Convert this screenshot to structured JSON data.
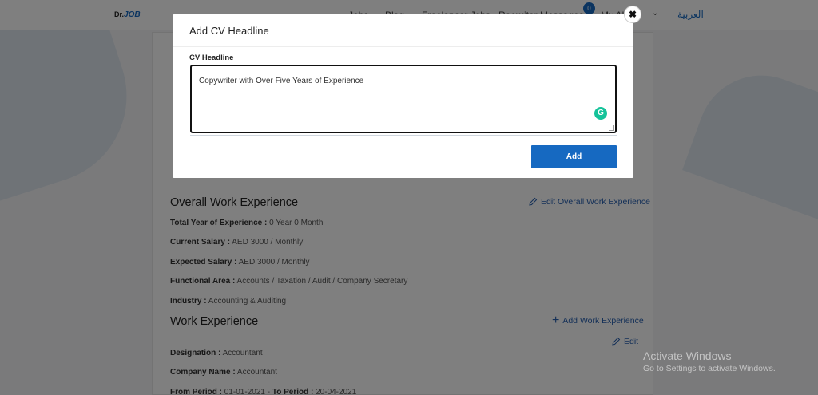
{
  "header": {
    "logo_prefix": "Dr.",
    "logo_brand": "JOB",
    "nav": [
      "Jobs",
      "Blog",
      "Freelancer Jobs",
      "Recruiter Messages",
      "My Alerts"
    ],
    "messages_badge": "0",
    "language_link": "العربية"
  },
  "profile": {
    "overall_title": "Overall Work Experience",
    "overall_edit_label": "Edit Overall Work Experience",
    "overall_rows": [
      {
        "label": "Total Year of Experience :",
        "value": "0 Year 0 Month"
      },
      {
        "label": "Current Salary :",
        "value": "AED 3000 / Monthly"
      },
      {
        "label": "Expected Salary :",
        "value": "AED 3000 / Monthly"
      },
      {
        "label": "Functional Area :",
        "value": "Accounts / Taxation / Audit / Company Secretary"
      },
      {
        "label": "Industry :",
        "value": "Accounting & Auditing"
      }
    ],
    "work_title": "Work Experience",
    "add_work_label": "Add Work Experience",
    "work_edit_label": "Edit",
    "work_rows": [
      {
        "label": "Designation :",
        "value": "Accountant"
      },
      {
        "label": "Company Name :",
        "value": "Accountant"
      }
    ],
    "period": {
      "from_label": "From Period :",
      "from_value": "01-01-2021",
      "to_label": "To Period :",
      "to_value": "20-04-2021"
    }
  },
  "modal": {
    "title": "Add CV Headline",
    "field_label": "CV Headline",
    "field_value": "Copywriter with Over Five Years of Experience",
    "grammarly_icon": "G",
    "add_label": "Add",
    "close_icon": "✖"
  },
  "watermark": {
    "line1": "Activate Windows",
    "line2": "Go to Settings to activate Windows."
  },
  "colors": {
    "accent": "#1669c1",
    "link": "#2860b0",
    "grammarly": "#15c39a"
  }
}
